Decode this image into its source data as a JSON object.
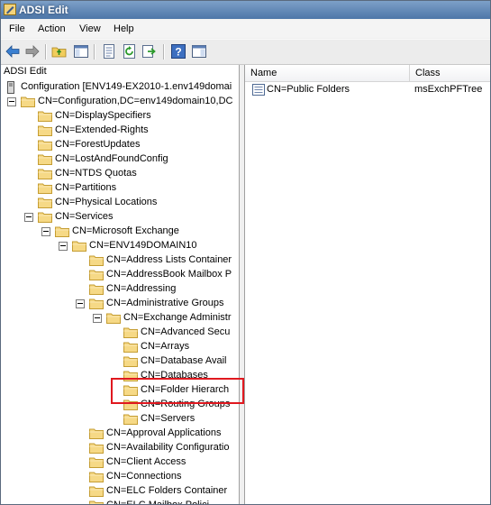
{
  "window": {
    "title": "ADSI Edit"
  },
  "menu": [
    "File",
    "Action",
    "View",
    "Help"
  ],
  "toolbar": [
    "back-arrow-icon",
    "forward-arrow-icon",
    "up-folder-icon",
    "show-hide-tree-icon",
    "properties-icon",
    "refresh-icon",
    "export-list-icon",
    "help-icon",
    "show-hide-action-pane-icon"
  ],
  "tree": {
    "root": "ADSI Edit",
    "items": [
      "Configuration [ENV149-EX2010-1.env149domai",
      "CN=Configuration,DC=env149domain10,DC",
      "CN=DisplaySpecifiers",
      "CN=Extended-Rights",
      "CN=ForestUpdates",
      "CN=LostAndFoundConfig",
      "CN=NTDS Quotas",
      "CN=Partitions",
      "CN=Physical Locations",
      "CN=Services",
      "CN=Microsoft Exchange",
      "CN=ENV149DOMAIN10",
      "CN=Address Lists Container",
      "CN=AddressBook Mailbox P",
      "CN=Addressing",
      "CN=Administrative Groups",
      "CN=Exchange Administr",
      "CN=Advanced Secu",
      "CN=Arrays",
      "CN=Database Avail",
      "CN=Databases",
      "CN=Folder Hierarch",
      "CN=Routing Groups",
      "CN=Servers",
      "CN=Approval Applications",
      "CN=Availability Configuratio",
      "CN=Client Access",
      "CN=Connections",
      "CN=ELC Folders Container",
      "CN=ELC Mailbox Polici"
    ]
  },
  "list": {
    "columns": [
      "Name",
      "Class"
    ],
    "rows": [
      {
        "name": "CN=Public Folders",
        "class": "msExchPFTree"
      }
    ]
  },
  "colors": {
    "highlight": "#e0181f",
    "titlebar": "#4d76a8"
  }
}
